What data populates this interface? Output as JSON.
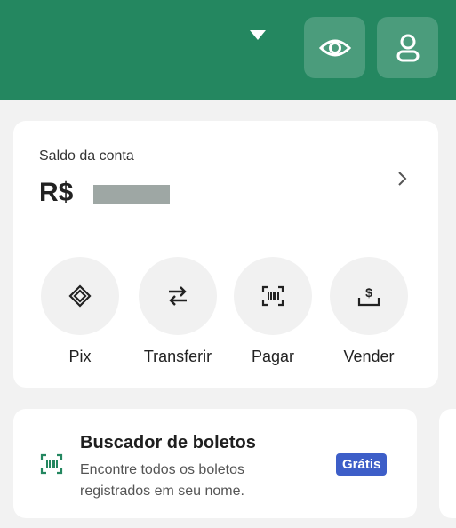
{
  "header": {
    "background": "#248760"
  },
  "balance": {
    "label": "Saldo da conta",
    "currency": "R$"
  },
  "actions": [
    {
      "label": "Pix",
      "icon": "pix-icon"
    },
    {
      "label": "Transferir",
      "icon": "transfer-arrows-icon"
    },
    {
      "label": "Pagar",
      "icon": "barcode-icon"
    },
    {
      "label": "Vender",
      "icon": "sell-tray-icon"
    }
  ],
  "boleto_finder": {
    "title": "Buscador de boletos",
    "description": "Encontre todos os boletos registrados em seu nome.",
    "badge": "Grátis",
    "badge_color": "#3d5ec8",
    "icon": "barcode-scan-icon"
  }
}
